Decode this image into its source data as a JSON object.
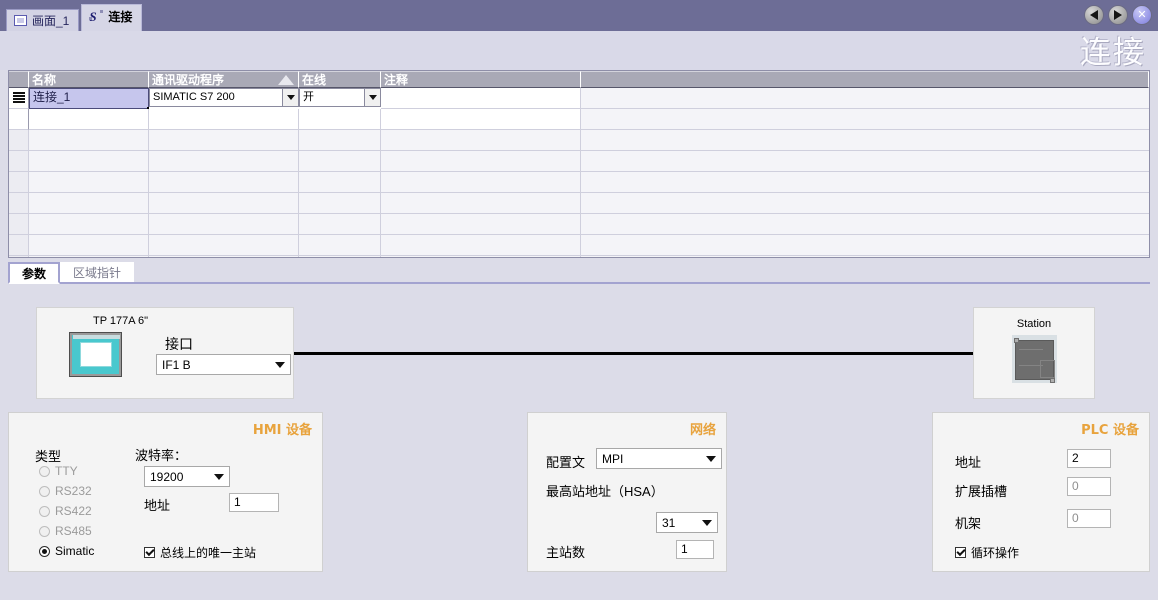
{
  "window": {
    "watermark": "连接",
    "nav_prev_label": "◀",
    "nav_next_label": "▶",
    "close_label": "✕"
  },
  "doc_tabs": [
    {
      "label": "画面_1",
      "icon": "screen-icon",
      "active": false
    },
    {
      "label": "连接",
      "icon": "connection-icon",
      "active": true
    }
  ],
  "grid": {
    "columns": [
      "名称",
      "通讯驱动程序",
      "在线",
      "注释"
    ],
    "sorted_column": "通讯驱动程序",
    "rows": [
      {
        "name": "连接_1",
        "driver": "SIMATIC S7 200",
        "online": "开",
        "comment": ""
      }
    ]
  },
  "property_tabs": [
    {
      "label": "参数",
      "active": true
    },
    {
      "label": "区域指针",
      "active": false
    }
  ],
  "diagram": {
    "hmi": {
      "device_name": "TP 177A 6\"",
      "interface_label": "接口",
      "interface_value": "IF1 B"
    },
    "station": {
      "label": "Station"
    }
  },
  "hmi_panel": {
    "title": "HMI 设备",
    "type_label": "类型",
    "types": [
      {
        "label": "TTY",
        "selected": false
      },
      {
        "label": "RS232",
        "selected": false
      },
      {
        "label": "RS422",
        "selected": false
      },
      {
        "label": "RS485",
        "selected": false
      },
      {
        "label": "Simatic",
        "selected": true
      }
    ],
    "baud_label": "波特率：",
    "baud_value": "19200",
    "address_label": "地址",
    "address_value": "1",
    "only_master_label": "总线上的唯一主站",
    "only_master_checked": true
  },
  "network_panel": {
    "title": "网络",
    "profile_label": "配置文",
    "profile_value": "MPI",
    "hsa_label": "最高站地址（HSA）",
    "hsa_value": "31",
    "masters_label": "主站数",
    "masters_value": "1"
  },
  "plc_panel": {
    "title": "PLC 设备",
    "address_label": "地址",
    "address_value": "2",
    "expansion_slot_label": "扩展插槽",
    "expansion_slot_value": "0",
    "rack_label": "机架",
    "rack_value": "0",
    "cyclic_label": "循环操作",
    "cyclic_checked": true
  },
  "colors": {
    "titlebar": "#6d6d96",
    "page_bg": "#dcdce8",
    "panel_bg": "#f4f4f4",
    "accent_orange": "#e8a33d",
    "selection": "#c6c6ed",
    "grid_header": "#a9a9b6"
  }
}
